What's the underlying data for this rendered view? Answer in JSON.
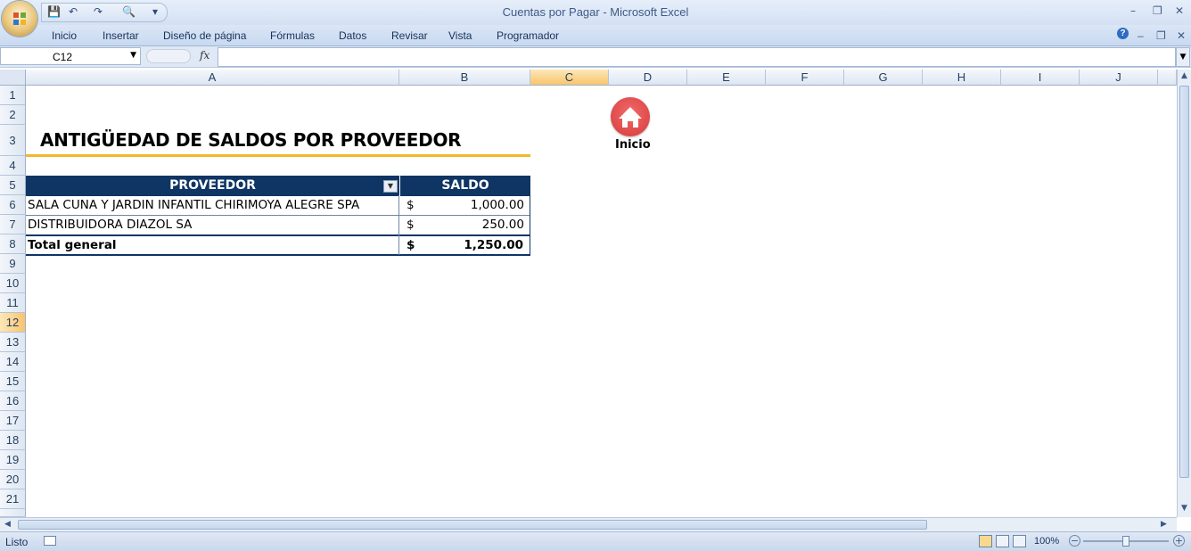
{
  "window": {
    "title": "Cuentas por Pagar - Microsoft Excel",
    "minimize": "–",
    "restore": "❐",
    "close": "✕"
  },
  "qat": {
    "save": "💾",
    "undo": "↶",
    "redo": "↷",
    "preview": "🔍",
    "more": "▾"
  },
  "ribbon": {
    "tabs": [
      "Inicio",
      "Insertar",
      "Diseño de página",
      "Fórmulas",
      "Datos",
      "Revisar",
      "Vista",
      "Programador"
    ],
    "help": "?"
  },
  "formula_bar": {
    "name_box": "C12",
    "fx": "fx",
    "formula": ""
  },
  "sheet": {
    "columns": [
      "A",
      "B",
      "C",
      "D",
      "E",
      "F",
      "G",
      "H",
      "I",
      "J"
    ],
    "selected_column": "C",
    "rows": [
      "1",
      "2",
      "3",
      "4",
      "5",
      "6",
      "7",
      "8",
      "9",
      "10",
      "11",
      "12",
      "13",
      "14",
      "15",
      "16",
      "17",
      "18",
      "19",
      "20",
      "21"
    ],
    "selected_row": "12"
  },
  "report": {
    "title": "ANTIGÜEDAD DE SALDOS POR PROVEEDOR",
    "header_proveedor": "PROVEEDOR",
    "header_saldo": "SALDO",
    "rows": [
      {
        "proveedor": "SALA CUNA Y JARDIN INFANTIL CHIRIMOYA ALEGRE SPA",
        "currency": "$",
        "saldo": "1,000.00"
      },
      {
        "proveedor": "DISTRIBUIDORA DIAZOL SA",
        "currency": "$",
        "saldo": "250.00"
      }
    ],
    "total": {
      "label": "Total general",
      "currency": "$",
      "saldo": "1,250.00"
    }
  },
  "home_button": {
    "label": "Inicio"
  },
  "status": {
    "text": "Listo",
    "zoom": "100%"
  }
}
